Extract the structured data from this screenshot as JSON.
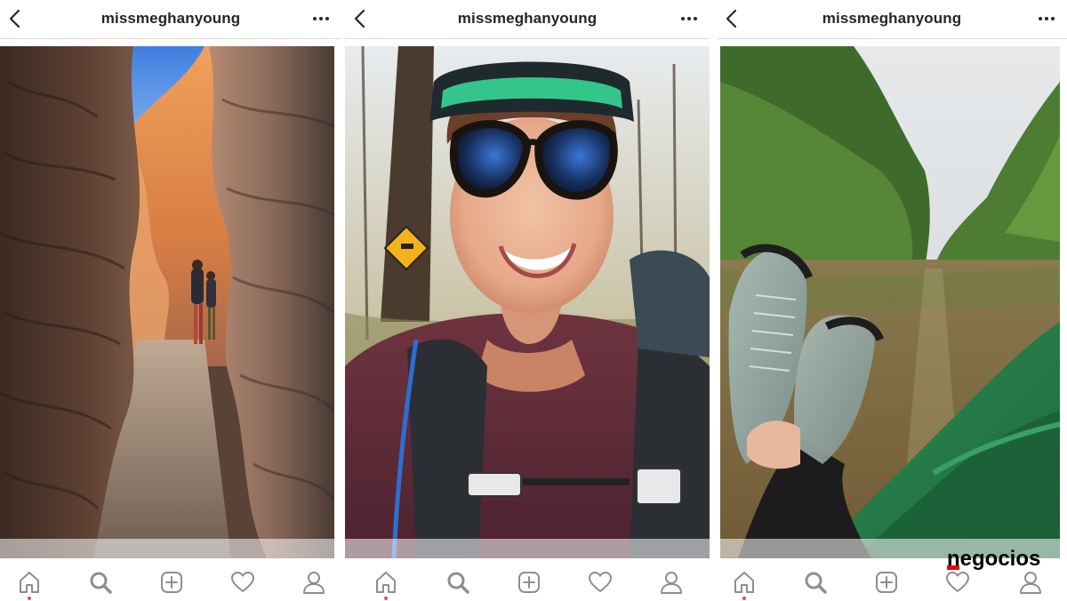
{
  "screens": [
    {
      "username": "missmeghanyoung",
      "photo": "slot-canyon-hikers",
      "active_tab_dot": true
    },
    {
      "username": "missmeghanyoung",
      "photo": "woman-selfie-helmet-sunglasses",
      "active_tab_dot": true
    },
    {
      "username": "missmeghanyoung",
      "photo": "feet-on-boat-river-jungle",
      "active_tab_dot": false
    }
  ],
  "icons": {
    "back": "chevron-left-icon",
    "more": "more-dots-icon",
    "tabs": [
      "home-icon",
      "search-icon",
      "add-post-icon",
      "heart-icon",
      "profile-icon"
    ]
  },
  "watermark": {
    "text": "negocios"
  },
  "colors": {
    "text": "#262626",
    "icon": "#8e8e8e",
    "border": "#dbdbdb",
    "dot": "#ed4956",
    "watermark_red": "#e30613"
  }
}
